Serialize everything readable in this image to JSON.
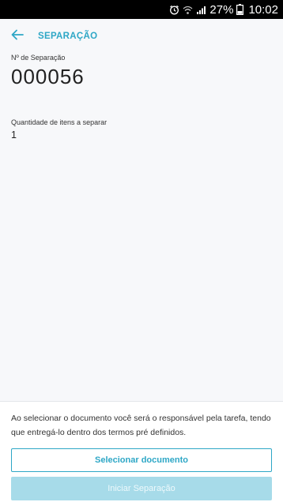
{
  "status_bar": {
    "battery_percent": "27%",
    "time": "10:02",
    "icons": [
      "alarm-icon",
      "wifi-icon",
      "signal-icon",
      "battery-icon"
    ]
  },
  "app_bar": {
    "title": "SEPARAÇÃO",
    "back_icon": "arrow-left-icon"
  },
  "separation": {
    "number_label": "Nº de Separação",
    "number_value": "000056",
    "items_label": "Quantidade de itens a separar",
    "items_value": "1"
  },
  "footer": {
    "notice": "Ao selecionar o documento você será o responsável pela tarefa, tendo que entregá-lo dentro dos termos pré definidos.",
    "select_button_label": "Selecionar documento",
    "start_button_label": "Iniciar Separação"
  },
  "colors": {
    "accent": "#2ea7c6",
    "disabled_button": "#a7dbe9",
    "background": "#f7f8fa"
  }
}
